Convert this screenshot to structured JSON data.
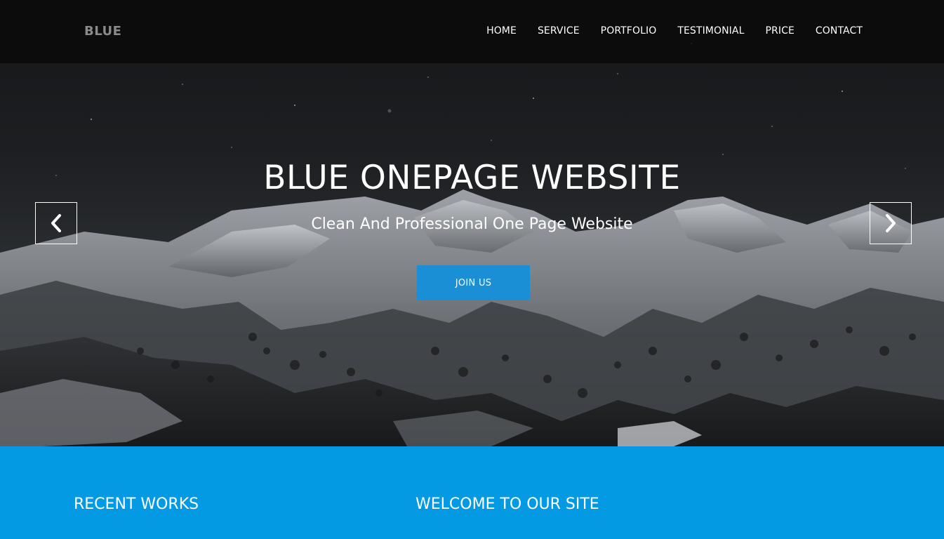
{
  "brand": "BLUE",
  "nav": {
    "items": [
      {
        "label": "HOME"
      },
      {
        "label": "SERVICE"
      },
      {
        "label": "PORTFOLIO"
      },
      {
        "label": "TESTIMONIAL"
      },
      {
        "label": "PRICE"
      },
      {
        "label": "CONTACT"
      }
    ]
  },
  "hero": {
    "title": "BLUE ONEPAGE WEBSITE",
    "subtitle": "Clean And Professional One Page Website",
    "cta_label": "JOIN US",
    "prev_icon": "chevron-left-icon",
    "next_icon": "chevron-right-icon"
  },
  "section": {
    "left_heading": "RECENT WORKS",
    "right_heading": "WELCOME TO OUR SITE"
  },
  "colors": {
    "accent_blue": "#039ae3",
    "button_blue": "#1a8fd6",
    "nav_bg": "#0a0a0a",
    "brand_gray": "#8a8a8a"
  }
}
